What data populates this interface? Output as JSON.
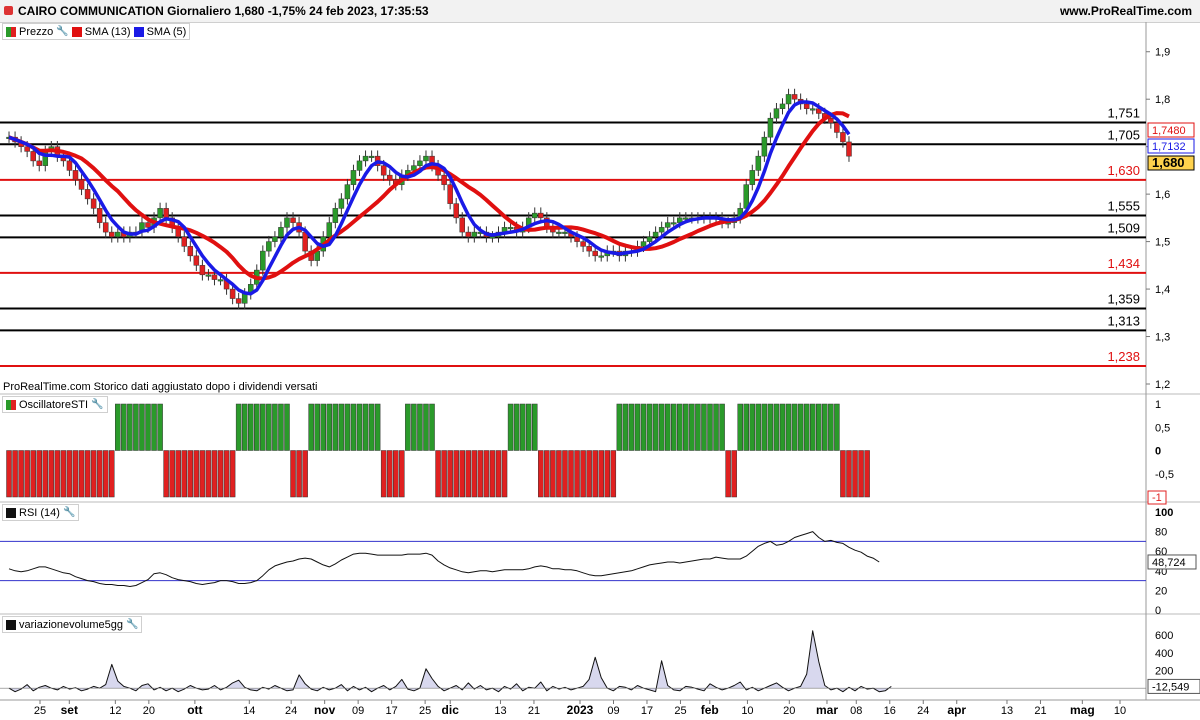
{
  "header": {
    "title": "CAIRO COMMUNICATION Giornaliero 1,680 -1,75% 24 feb 2023, 17:35:53",
    "site": "www.ProRealTime.com"
  },
  "footnote": "ProRealTime.com  Storico dati aggiustato dopo i dividendi versati",
  "colors": {
    "up": "#2a9a2a",
    "down": "#e02020",
    "sma13": "#e01010",
    "sma5": "#1a1ae6",
    "hline": "#000000",
    "hline_red": "#e01010",
    "rsi_band": "#3333cc"
  },
  "chart_data": [
    {
      "type": "candlestick",
      "panel": "price",
      "legend": [
        {
          "label": "Prezzo",
          "color": "#2a9a2a"
        },
        {
          "label": "SMA (13)",
          "color": "#e01010"
        },
        {
          "label": "SMA (5)",
          "color": "#1a1ae6"
        }
      ],
      "ylim": [
        1.2,
        1.95
      ],
      "yticks": [
        "1,9",
        "1,8",
        "1,7",
        "1,6",
        "1,5",
        "1,4",
        "1,3",
        "1,2"
      ],
      "ytick_values": [
        1.9,
        1.8,
        1.7,
        1.6,
        1.5,
        1.4,
        1.3,
        1.2
      ],
      "horizontal_levels": [
        {
          "value": 1.751,
          "label": "1,751",
          "color": "black"
        },
        {
          "value": 1.705,
          "label": "1,705",
          "color": "black"
        },
        {
          "value": 1.63,
          "label": "1,630",
          "color": "red"
        },
        {
          "value": 1.555,
          "label": "1,555",
          "color": "black"
        },
        {
          "value": 1.509,
          "label": "1,509",
          "color": "black"
        },
        {
          "value": 1.434,
          "label": "1,434",
          "color": "red"
        },
        {
          "value": 1.359,
          "label": "1,359",
          "color": "black"
        },
        {
          "value": 1.313,
          "label": "1,313",
          "color": "black"
        },
        {
          "value": 1.238,
          "label": "1,238",
          "color": "red"
        }
      ],
      "last_values": [
        {
          "label": "1,7480",
          "color": "#e01010"
        },
        {
          "label": "1,7132",
          "color": "#1a1ae6"
        },
        {
          "label": "1,680",
          "color": "#000000"
        }
      ],
      "close": [
        1.72,
        1.71,
        1.7,
        1.69,
        1.67,
        1.66,
        1.69,
        1.7,
        1.68,
        1.67,
        1.65,
        1.63,
        1.61,
        1.59,
        1.57,
        1.54,
        1.52,
        1.51,
        1.52,
        1.51,
        1.52,
        1.52,
        1.54,
        1.53,
        1.55,
        1.57,
        1.55,
        1.53,
        1.51,
        1.49,
        1.47,
        1.45,
        1.43,
        1.43,
        1.42,
        1.42,
        1.4,
        1.38,
        1.37,
        1.39,
        1.41,
        1.44,
        1.48,
        1.5,
        1.51,
        1.53,
        1.55,
        1.54,
        1.52,
        1.48,
        1.46,
        1.48,
        1.51,
        1.54,
        1.57,
        1.59,
        1.62,
        1.65,
        1.67,
        1.68,
        1.68,
        1.66,
        1.64,
        1.63,
        1.62,
        1.64,
        1.65,
        1.66,
        1.67,
        1.68,
        1.66,
        1.64,
        1.62,
        1.58,
        1.55,
        1.52,
        1.51,
        1.52,
        1.52,
        1.51,
        1.51,
        1.52,
        1.53,
        1.53,
        1.52,
        1.53,
        1.55,
        1.56,
        1.55,
        1.53,
        1.52,
        1.52,
        1.52,
        1.51,
        1.5,
        1.49,
        1.48,
        1.47,
        1.47,
        1.48,
        1.48,
        1.47,
        1.48,
        1.48,
        1.49,
        1.5,
        1.51,
        1.52,
        1.53,
        1.54,
        1.54,
        1.55,
        1.55,
        1.55,
        1.55,
        1.55,
        1.55,
        1.55,
        1.54,
        1.54,
        1.55,
        1.57,
        1.62,
        1.65,
        1.68,
        1.72,
        1.76,
        1.78,
        1.79,
        1.81,
        1.8,
        1.79,
        1.78,
        1.78,
        1.77,
        1.76,
        1.75,
        1.73,
        1.71,
        1.68
      ]
    },
    {
      "type": "bar",
      "panel": "oscillator",
      "name": "OscillatoreSTI",
      "ylim": [
        -1,
        1
      ],
      "yticks": [
        "1",
        "0,5",
        "0",
        "-0,5"
      ],
      "ytick_values": [
        1,
        0.5,
        0,
        -0.5
      ],
      "last_value": "-1",
      "segments": [
        {
          "value": -1,
          "count": 18
        },
        {
          "value": 1,
          "count": 8
        },
        {
          "value": -1,
          "count": 12
        },
        {
          "value": 1,
          "count": 9
        },
        {
          "value": -1,
          "count": 3
        },
        {
          "value": 1,
          "count": 12
        },
        {
          "value": -1,
          "count": 4
        },
        {
          "value": 1,
          "count": 5
        },
        {
          "value": -1,
          "count": 12
        },
        {
          "value": 1,
          "count": 5
        },
        {
          "value": -1,
          "count": 13
        },
        {
          "value": 1,
          "count": 18
        },
        {
          "value": -1,
          "count": 2
        },
        {
          "value": 1,
          "count": 17
        },
        {
          "value": -1,
          "count": 5
        }
      ]
    },
    {
      "type": "line",
      "panel": "rsi",
      "name": "RSI (14)",
      "ylim": [
        0,
        100
      ],
      "yticks": [
        "100",
        "80",
        "60",
        "40",
        "20",
        "0"
      ],
      "ytick_values": [
        100,
        80,
        60,
        40,
        20,
        0
      ],
      "bands": [
        30,
        70
      ],
      "last_value": "48,724",
      "values": [
        42,
        40,
        39,
        40,
        42,
        44,
        44,
        42,
        40,
        38,
        37,
        34,
        32,
        30,
        29,
        27,
        26,
        26,
        25,
        25,
        24,
        25,
        28,
        31,
        37,
        38,
        36,
        33,
        31,
        30,
        29,
        27,
        26,
        27,
        28,
        30,
        30,
        29,
        27,
        27,
        28,
        30,
        35,
        41,
        45,
        47,
        49,
        50,
        52,
        53,
        52,
        49,
        46,
        44,
        47,
        51,
        54,
        57,
        58,
        58,
        57,
        56,
        56,
        56,
        56,
        56,
        57,
        57,
        57,
        58,
        56,
        50,
        46,
        43,
        41,
        39,
        38,
        39,
        40,
        40,
        39,
        40,
        41,
        41,
        41,
        41,
        42,
        44,
        45,
        44,
        42,
        42,
        41,
        41,
        40,
        38,
        36,
        35,
        35,
        36,
        37,
        38,
        39,
        40,
        42,
        44,
        46,
        47,
        48,
        49,
        49,
        48,
        49,
        50,
        51,
        52,
        52,
        54,
        53,
        52,
        52,
        52,
        55,
        60,
        65,
        68,
        70,
        66,
        67,
        70,
        74,
        76,
        78,
        80,
        74,
        70,
        71,
        69,
        68,
        64,
        61,
        59,
        55,
        53,
        49
      ]
    },
    {
      "type": "area",
      "panel": "volume",
      "name": "variazionevolume5gg",
      "ylim": [
        -100,
        750
      ],
      "yticks": [
        "600",
        "400",
        "200",
        "0"
      ],
      "ytick_values": [
        600,
        400,
        200,
        0
      ],
      "last_value": "-12,549",
      "values": [
        0,
        -40,
        -10,
        40,
        -30,
        10,
        30,
        0,
        -20,
        20,
        -10,
        5,
        -30,
        -10,
        20,
        0,
        40,
        270,
        80,
        20,
        0,
        -30,
        30,
        50,
        -20,
        10,
        -30,
        0,
        -40,
        -10,
        30,
        0,
        -20,
        -10,
        30,
        -20,
        10,
        60,
        90,
        10,
        -20,
        -30,
        10,
        -10,
        30,
        0,
        -30,
        -20,
        150,
        50,
        -10,
        -30,
        10,
        -20,
        0,
        40,
        -30,
        20,
        -20,
        10,
        -40,
        0,
        30,
        -20,
        20,
        100,
        -10,
        -30,
        0,
        220,
        110,
        20,
        -30,
        0,
        30,
        -20,
        60,
        -10,
        30,
        -20,
        0,
        -40,
        20,
        -10,
        50,
        -30,
        10,
        0,
        70,
        -30,
        20,
        -10,
        10,
        -20,
        0,
        20,
        100,
        350,
        120,
        0,
        -30,
        20,
        10,
        -20,
        30,
        0,
        -20,
        -40,
        310,
        30,
        -20,
        -30,
        20,
        10,
        -10,
        -30,
        50,
        10,
        -20,
        0,
        30,
        70,
        -20,
        10,
        -30,
        0,
        30,
        60,
        10,
        -30,
        0,
        20,
        160,
        650,
        300,
        30,
        -20,
        0,
        -40,
        10,
        -30,
        20,
        -10,
        0,
        -40,
        -30,
        20
      ]
    },
    {
      "type": "axis",
      "name": "time-axis",
      "tick_labels": [
        "25",
        "set",
        "12",
        "20",
        "ott",
        "14",
        "24",
        "nov",
        "09",
        "17",
        "25",
        "dic",
        "13",
        "21",
        "2023",
        "09",
        "17",
        "25",
        "feb",
        "10",
        "20",
        "mar",
        "08",
        "16",
        "24",
        "apr",
        "13",
        "21",
        "mag",
        "10"
      ],
      "tick_dates": [
        "2022-08-25",
        "2022-09-01",
        "2022-09-12",
        "2022-09-20",
        "2022-10-01",
        "2022-10-14",
        "2022-10-24",
        "2022-11-01",
        "2022-11-09",
        "2022-11-17",
        "2022-11-25",
        "2022-12-01",
        "2022-12-13",
        "2022-12-21",
        "2023-01-01",
        "2023-01-09",
        "2023-01-17",
        "2023-01-25",
        "2023-02-01",
        "2023-02-10",
        "2023-02-20",
        "2023-03-01",
        "2023-03-08",
        "2023-03-16",
        "2023-03-24",
        "2023-04-01",
        "2023-04-13",
        "2023-04-21",
        "2023-05-01",
        "2023-05-10"
      ],
      "bold_labels": [
        "set",
        "ott",
        "nov",
        "dic",
        "2023",
        "feb",
        "mar",
        "apr",
        "mag"
      ]
    }
  ]
}
